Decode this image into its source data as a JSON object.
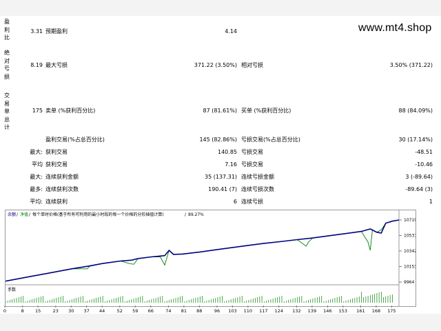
{
  "watermark": "www.mt4.shop",
  "left_labels": {
    "profit_factor": "盈\n利\n比",
    "absolute_drawdown": "绝\n对\n亏\n损",
    "total_trades": "交\n易\n单\n总\n计"
  },
  "stats": {
    "profit_factor_value": "3.31",
    "expected_payoff_label": "预期盈利",
    "expected_payoff_value": "4.14",
    "absolute_drawdown_value": "8.19",
    "maximal_drawdown_label": "最大亏损",
    "maximal_drawdown_value": "371.22 (3.50%)",
    "relative_drawdown_label": "相对亏损",
    "relative_drawdown_value": "3.50% (371.22)",
    "total_trades_value": "175",
    "short_positions_label": "卖单 (%获利百分比)",
    "short_positions_value": "87 (81.61%)",
    "long_positions_label": "买单 (%获利百分比)",
    "long_positions_value": "88 (84.09%)",
    "profit_trades_label": "盈利交易(%占总百分比)",
    "profit_trades_value": "145 (82.86%)",
    "loss_trades_label": "亏损交易(%占总百分比)",
    "loss_trades_value": "30 (17.14%)",
    "largest_prefix": "最大:",
    "largest_profit_label": "获利交易",
    "largest_profit_value": "140.85",
    "largest_loss_label": "亏损交易",
    "largest_loss_value": "-48.51",
    "average_prefix": "平均",
    "average_profit_label": "获利交易",
    "average_profit_value": "7.16",
    "average_loss_label": "亏损交易",
    "average_loss_value": "-10.46",
    "max_prefix": "最大:",
    "max_consec_wins_label": "连续获利金额",
    "max_consec_wins_value": "35 (137.31)",
    "max_consec_losses_label": "连续亏损金额",
    "max_consec_losses_value": "3 (-89.64)",
    "maximal_prefix": "最多:",
    "maximal_consec_profit_label": "连续获利次数",
    "maximal_consec_profit_value": "190.41 (7)",
    "maximal_consec_loss_label": "连续亏损次数",
    "maximal_consec_loss_value": "-89.64 (3)",
    "avg_consec_prefix": "平均:",
    "avg_consec_wins_label": "连续获利",
    "avg_consec_wins_value": "6",
    "avg_consec_losses_label": "连续亏损",
    "avg_consec_losses_value": "1"
  },
  "chart_header": {
    "balance_label": "余额",
    "equity_label": "净值",
    "description": "每个单时价格(基于所有可利用的最小时段的每一个价格的分形插值计算)",
    "quality": "89.27%"
  },
  "chart_data": {
    "type": "line",
    "y_ticks": [
      9964,
      10153,
      10342,
      10531,
      10719
    ],
    "ylim": [
      9964,
      10719
    ],
    "x_ticks": [
      "0",
      "8",
      "15",
      "23",
      "30",
      "37",
      "44",
      "52",
      "59",
      "66",
      "74",
      "81",
      "88",
      "96",
      "103",
      "110",
      "117",
      "124",
      "132",
      "139",
      "146",
      "153",
      "161",
      "168",
      "175"
    ],
    "xlim": [
      0,
      178
    ],
    "lot_label": "手数",
    "series": [
      {
        "color": "#000080",
        "x": [
          0,
          10,
          20,
          30,
          37,
          44,
          52,
          57,
          60,
          66,
          72,
          74,
          76,
          80,
          88,
          96,
          103,
          110,
          117,
          124,
          132,
          139,
          146,
          153,
          161,
          165,
          168,
          170,
          172,
          175,
          178
        ],
        "y": [
          9975,
          10025,
          10075,
          10125,
          10155,
          10190,
          10220,
          10230,
          10250,
          10270,
          10285,
          10350,
          10300,
          10305,
          10330,
          10360,
          10385,
          10410,
          10435,
          10455,
          10480,
          10500,
          10525,
          10550,
          10580,
          10610,
          10570,
          10560,
          10680,
          10705,
          10719
        ]
      },
      {
        "color": "#008000",
        "x": [
          0,
          10,
          20,
          30,
          37,
          38,
          44,
          52,
          56,
          58,
          60,
          66,
          70,
          72,
          74,
          76,
          80,
          88,
          96,
          103,
          110,
          117,
          124,
          132,
          136,
          137,
          139,
          146,
          153,
          161,
          164,
          165,
          166,
          168,
          170,
          172,
          175,
          178
        ],
        "y": [
          9975,
          10025,
          10075,
          10125,
          10125,
          10155,
          10190,
          10220,
          10190,
          10180,
          10250,
          10270,
          10270,
          10170,
          10350,
          10300,
          10305,
          10330,
          10360,
          10385,
          10410,
          10435,
          10455,
          10480,
          10400,
          10450,
          10500,
          10525,
          10550,
          10580,
          10450,
          10350,
          10600,
          10570,
          10600,
          10680,
          10705,
          10719
        ]
      }
    ]
  }
}
